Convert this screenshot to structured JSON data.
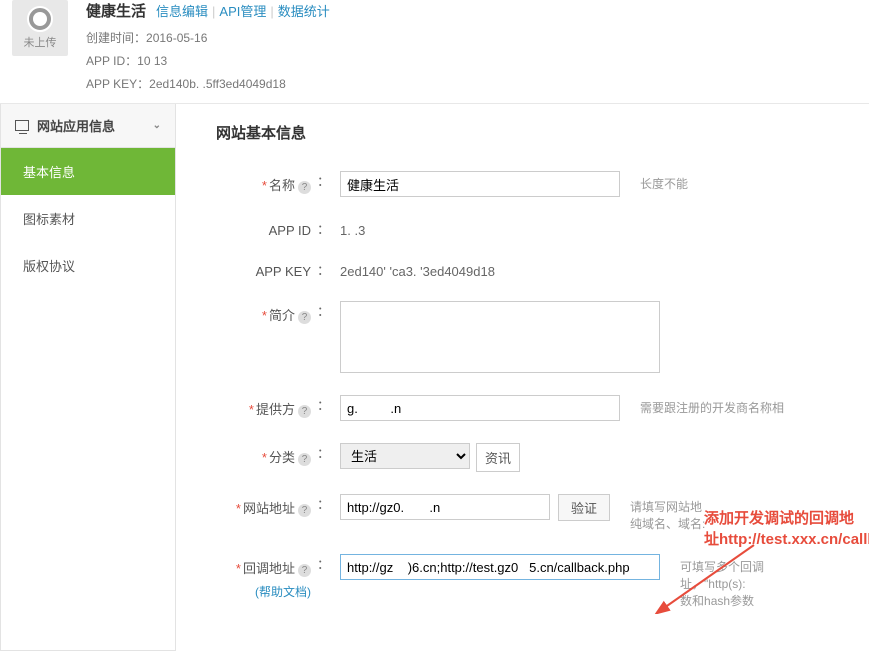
{
  "header": {
    "avatar_label": "未上传",
    "app_name": "健康生活",
    "links": {
      "edit": "信息编辑",
      "api": "API管理",
      "stats": "数据统计"
    },
    "create_time_label": "创建时间：",
    "create_time": "2016-05-16",
    "appid_label": "APP ID：",
    "appid": "10          13",
    "appkey_label": "APP KEY：",
    "appkey": "2ed140b.            .5ff3ed4049d18"
  },
  "sidebar": {
    "header": "网站应用信息",
    "items": [
      "基本信息",
      "图标素材",
      "版权协议"
    ]
  },
  "main": {
    "title": "网站基本信息",
    "labels": {
      "name": "名称",
      "appid": "APP ID",
      "appkey": "APP KEY",
      "intro": "简介",
      "provider": "提供方",
      "category": "分类",
      "siteurl": "网站地址",
      "callback": "回调地址"
    },
    "values": {
      "name": "健康生活",
      "appid": "1.         .3",
      "appkey": "2ed140'       'ca3.        '3ed4049d18",
      "intro": "",
      "provider": "g.         .n",
      "category_select": "生活",
      "category_tag": "资讯",
      "siteurl": "http://gz0.       .n",
      "callback": "http://gz    )6.cn;http://test.gz0   5.cn/callback.php"
    },
    "hints": {
      "name": "长度不能",
      "provider": "需要跟注册的开发商名称相",
      "siteurl": "请填写网站地",
      "siteurl2": "纯域名、域名:",
      "callback": "可填写多个回调",
      "callback2": "址，\"http(s):",
      "callback3": "数和hash参数"
    },
    "verify_btn": "验证",
    "help_link": "(帮助文档)",
    "annotation": {
      "line1": "添加开发调试的回调地",
      "line2": "址http://test.xxx.cn/callback.php"
    }
  }
}
